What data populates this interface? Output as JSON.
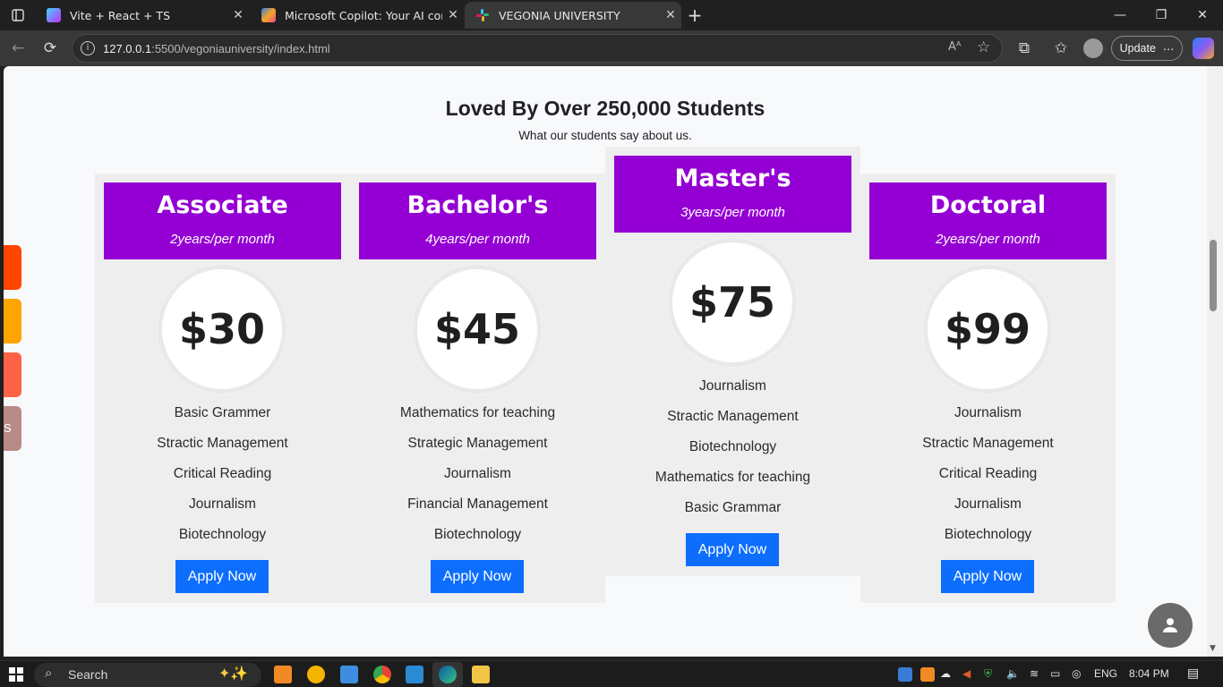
{
  "browser": {
    "tabs": [
      {
        "title": "Vite + React + TS",
        "icon": "vite-icon",
        "color": "#8a5cf6"
      },
      {
        "title": "Microsoft Copilot: Your AI compa",
        "icon": "copilot-icon",
        "color": "#2f7bf5"
      },
      {
        "title": "VEGONIA UNIVERSITY",
        "icon": "slack-icon",
        "color": "#e01e5a"
      }
    ],
    "url_host": "127.0.0.1",
    "url_path": ":5500/vegoniauniversity/index.html",
    "update_label": "Update",
    "new_tab_symbol": "+"
  },
  "page": {
    "title": "Loved By Over 250,000 Students",
    "subtitle": "What our students say about us.",
    "plans": [
      {
        "name": "Associate",
        "term": "2years/per month",
        "price": "$30",
        "features": [
          "Basic Grammer",
          "Stractic Management",
          "Critical Reading",
          "Journalism",
          "Biotechnology"
        ],
        "cta": "Apply Now"
      },
      {
        "name": "Bachelor's",
        "term": "4years/per month",
        "price": "$45",
        "features": [
          "Mathematics for teaching",
          "Strategic Management",
          "Journalism",
          "Financial Management",
          "Biotechnology"
        ],
        "cta": "Apply Now"
      },
      {
        "name": "Master's",
        "term": "3years/per month",
        "price": "$75",
        "features": [
          "Journalism",
          "Stractic Management",
          "Biotechnology",
          "Mathematics for teaching",
          "Basic Grammar"
        ],
        "cta": "Apply Now"
      },
      {
        "name": "Doctoral",
        "term": "2years/per month",
        "price": "$99",
        "features": [
          "Journalism",
          "Stractic Management",
          "Critical Reading",
          "Journalism",
          "Biotechnology"
        ],
        "cta": "Apply Now"
      }
    ],
    "side_tab_letter": "S",
    "colors": {
      "header": "#9400d3",
      "button": "#0d6efd",
      "card": "#eeeeef"
    }
  },
  "taskbar": {
    "search_label": "Search",
    "language": "ENG",
    "time": "8:04 PM"
  }
}
